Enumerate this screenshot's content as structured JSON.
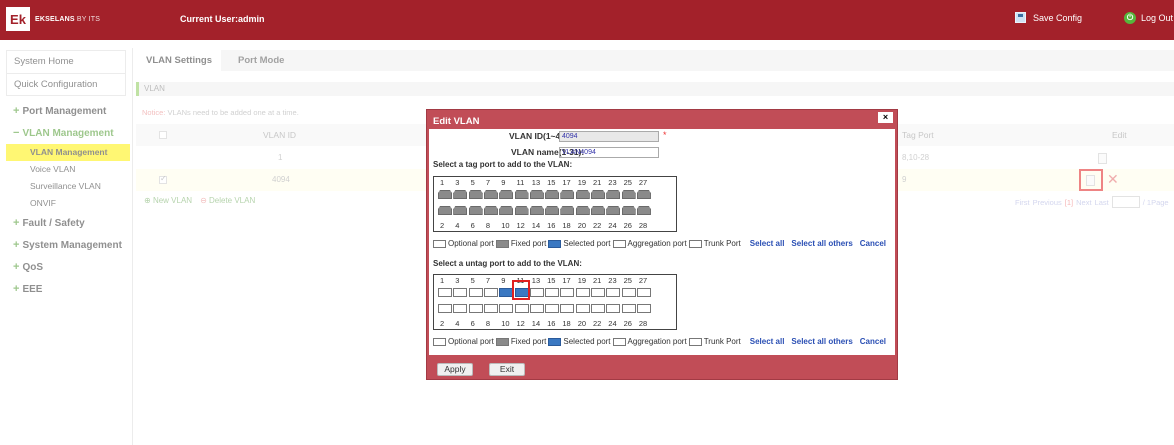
{
  "header": {
    "logo_mark": "Ek",
    "logo_brand": "EKSELANS",
    "logo_suffix": "BY ITS",
    "current_user": "Current User:admin",
    "save_config": "Save Config",
    "logout": "Log Out"
  },
  "sidebar": {
    "home": "System Home",
    "quick": "Quick Configuration",
    "groups": [
      {
        "sign": "+",
        "label": "Port Management"
      },
      {
        "sign": "−",
        "label": "VLAN Management"
      },
      {
        "sign": "+",
        "label": "Fault / Safety"
      },
      {
        "sign": "+",
        "label": "System Management"
      },
      {
        "sign": "+",
        "label": "QoS"
      },
      {
        "sign": "+",
        "label": "EEE"
      }
    ],
    "vlan_items": [
      "VLAN Management",
      "Voice VLAN",
      "Surveillance VLAN",
      "ONVIF"
    ]
  },
  "tabs": {
    "active": "VLAN Settings",
    "inactive": "Port Mode"
  },
  "crumb": "VLAN",
  "notice": {
    "label": "Notice:",
    "text": "VLANs need to be added one at a time."
  },
  "table": {
    "headers": {
      "vlan_id": "VLAN ID",
      "tag_port": "Tag Port",
      "edit": "Edit"
    },
    "rows": [
      {
        "vlan_id": "1",
        "tag_port": "8,10-28",
        "checked": false
      },
      {
        "vlan_id": "4094",
        "tag_port": "9",
        "checked": true
      }
    ],
    "new_vlan": "New VLAN",
    "delete_vlan": "Delete VLAN",
    "pager": {
      "first": "First",
      "previous": "Previous",
      "current": "[1]",
      "next": "Next",
      "last": "Last",
      "page_suffix": "/ 1Page"
    }
  },
  "dialog": {
    "title": "Edit VLAN",
    "close": "×",
    "vlan_id_label": "VLAN ID(1~4094):",
    "vlan_id_value": "4094",
    "vlan_name_label": "VLAN name(1-31):",
    "vlan_name_value": "VLAN4094",
    "required_mark": "*",
    "tag_label": "Select a tag port to add to the VLAN:",
    "untag_label": "Select a untag port to add to the VLAN:",
    "top_numbers": [
      "1",
      "3",
      "5",
      "7",
      "9",
      "11",
      "13",
      "15",
      "17",
      "19",
      "21",
      "23",
      "25",
      "27"
    ],
    "bottom_numbers": [
      "2",
      "4",
      "6",
      "8",
      "10",
      "12",
      "14",
      "16",
      "18",
      "20",
      "22",
      "24",
      "26",
      "28"
    ],
    "legend": {
      "optional": "Optional port",
      "fixed": "Fixed port",
      "selected": "Selected port",
      "aggregation": "Aggregation port",
      "trunk": "Trunk Port",
      "select_all": "Select all",
      "select_others": "Select all others",
      "cancel": "Cancel"
    },
    "apply": "Apply",
    "exit": "Exit"
  },
  "colors": {
    "brand": "#a3212a",
    "dialog": "#c14d57",
    "selected_port": "#3a78c2",
    "highlight": "#fff100"
  }
}
